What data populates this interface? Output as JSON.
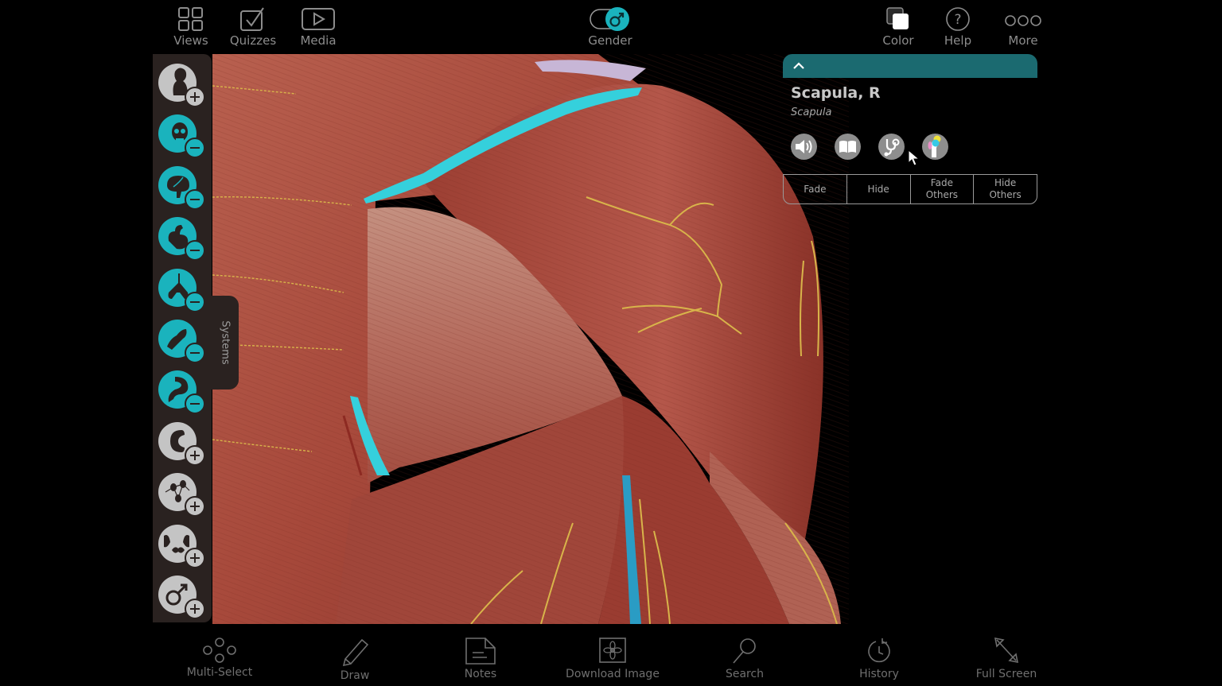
{
  "topbar": {
    "left": [
      {
        "id": "views",
        "label": "Views",
        "icon": "grid-icon"
      },
      {
        "id": "quizzes",
        "label": "Quizzes",
        "icon": "checkbox-icon"
      },
      {
        "id": "media",
        "label": "Media",
        "icon": "play-icon"
      }
    ],
    "center": {
      "id": "gender",
      "label": "Gender",
      "icon": "male-toggle-icon",
      "state": "male"
    },
    "right": [
      {
        "id": "color",
        "label": "Color",
        "icon": "color-squares-icon"
      },
      {
        "id": "help",
        "label": "Help",
        "icon": "help-icon"
      },
      {
        "id": "more",
        "label": "More",
        "icon": "more-dots-icon"
      }
    ]
  },
  "systems_panel": {
    "tab_label": "Systems",
    "items": [
      {
        "name": "skin",
        "state": "add",
        "color": "#c4c4c4"
      },
      {
        "name": "skeletal",
        "state": "remove",
        "color": "#1ab3bd"
      },
      {
        "name": "nervous",
        "state": "remove",
        "color": "#1ab3bd"
      },
      {
        "name": "cardiovascular",
        "state": "remove",
        "color": "#1ab3bd"
      },
      {
        "name": "respiratory",
        "state": "remove",
        "color": "#1ab3bd"
      },
      {
        "name": "muscular",
        "state": "remove",
        "color": "#1ab3bd"
      },
      {
        "name": "digestive",
        "state": "remove",
        "color": "#1ab3bd"
      },
      {
        "name": "urinary",
        "state": "add",
        "color": "#c4c4c4"
      },
      {
        "name": "lymphatic",
        "state": "add",
        "color": "#c4c4c4"
      },
      {
        "name": "endocrine",
        "state": "add",
        "color": "#c4c4c4"
      },
      {
        "name": "reproductive",
        "state": "add",
        "color": "#c4c4c4"
      }
    ]
  },
  "info_panel": {
    "title": "Scapula, R",
    "subtitle": "Scapula",
    "header_color": "#1b6a70",
    "icons": [
      "pronunciation-audio-icon",
      "definition-book-icon",
      "clinical-stethoscope-icon",
      "bone-markings-icon"
    ],
    "actions": [
      {
        "id": "fade",
        "label": "Fade"
      },
      {
        "id": "hide",
        "label": "Hide"
      },
      {
        "id": "fade-others",
        "label": "Fade Others"
      },
      {
        "id": "hide-others",
        "label": "Hide Others"
      }
    ]
  },
  "bottombar": [
    {
      "id": "multi-select",
      "label": "Multi-Select",
      "icon": "multi-select-icon"
    },
    {
      "id": "draw",
      "label": "Draw",
      "icon": "pencil-icon"
    },
    {
      "id": "notes",
      "label": "Notes",
      "icon": "note-icon"
    },
    {
      "id": "download-image",
      "label": "Download Image",
      "icon": "download-image-icon"
    },
    {
      "id": "search",
      "label": "Search",
      "icon": "search-icon"
    },
    {
      "id": "history",
      "label": "History",
      "icon": "history-icon"
    },
    {
      "id": "full-screen",
      "label": "Full Screen",
      "icon": "full-screen-icon"
    }
  ],
  "colors": {
    "accent": "#1ab3bd",
    "highlight": "#35d0dc",
    "muscle": "#a8473a",
    "nerve": "#d8b44a"
  }
}
